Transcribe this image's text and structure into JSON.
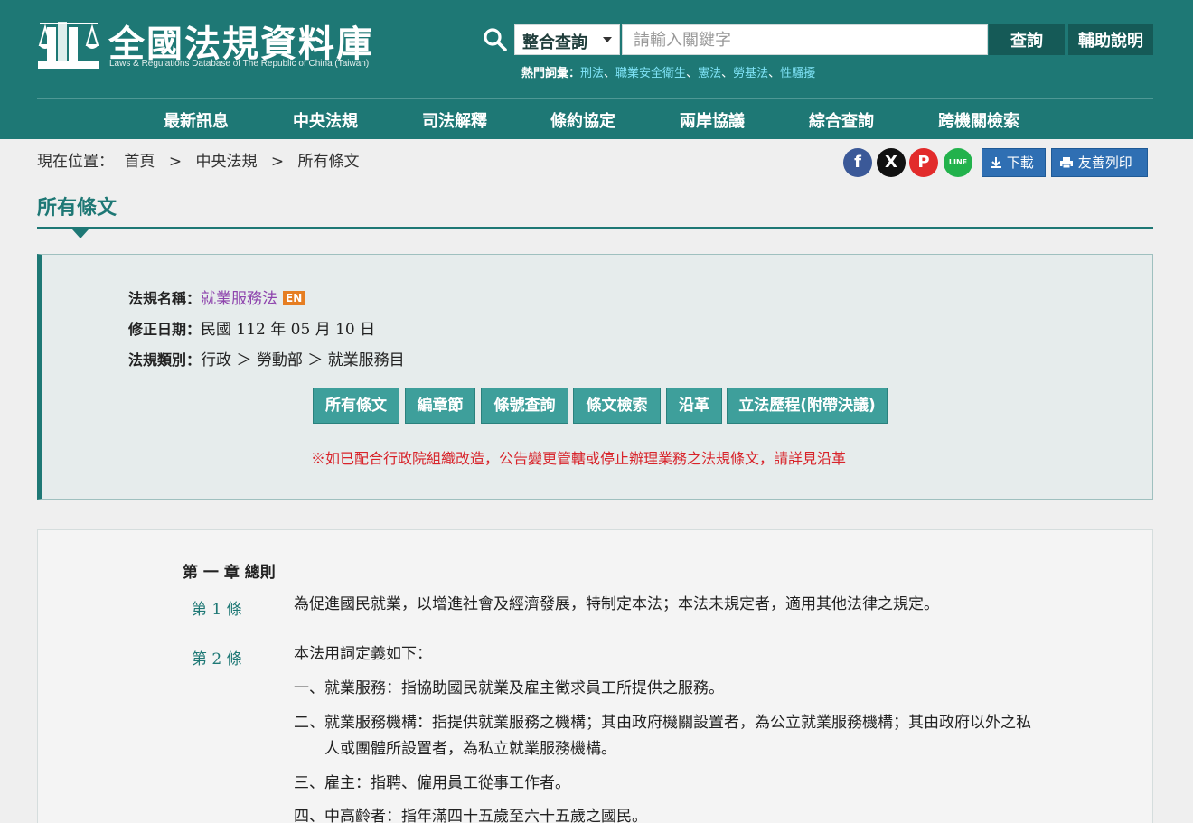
{
  "header": {
    "logo_title": "全國法規資料庫",
    "logo_subtitle": "Laws & Regulations Database of The Republic of China (Taiwan)",
    "search_type": "整合查詢",
    "search_placeholder": "請輸入關鍵字",
    "search_button": "查詢",
    "help_button": "輔助說明",
    "hot_label": "熱門詞彙：",
    "hot_keywords": [
      "刑法",
      "職業安全衛生",
      "憲法",
      "勞基法",
      "性騷擾"
    ],
    "hot_separator": "、"
  },
  "nav": {
    "items": [
      "最新訊息",
      "中央法規",
      "司法解釋",
      "條約協定",
      "兩岸協議",
      "綜合查詢",
      "跨機關檢索"
    ]
  },
  "breadcrumb": {
    "label": "現在位置：",
    "items": [
      "首頁",
      "中央法規",
      "所有條文"
    ],
    "separator": ">"
  },
  "toolbar": {
    "download": "下載",
    "print": "友善列印",
    "social": {
      "facebook": "f",
      "x": "X",
      "pinterest": "P",
      "line": "LINE"
    }
  },
  "page_title": "所有條文",
  "info": {
    "name_label": "法規名稱：",
    "name_value": "就業服務法",
    "en_badge": "EN",
    "date_label": "修正日期：",
    "date_value": "民國 112 年 05 月 10 日",
    "category_label": "法規類別：",
    "category_value": "行政 ＞ 勞動部 ＞ 就業服務目",
    "tabs": [
      "所有條文",
      "編章節",
      "條號查詢",
      "條文檢索",
      "沿革",
      "立法歷程(附帶決議)"
    ],
    "note": "※如已配合行政院組織改造，公告變更管轄或停止辦理業務之法規條文，請詳見沿革"
  },
  "content": {
    "chapter": "第 一 章 總則",
    "articles": [
      {
        "no": "第 1 條",
        "lines": [
          "為促進國民就業，以增進社會及經濟發展，特制定本法；本法未規定者，適用其他法律之規定。"
        ]
      },
      {
        "no": "第 2 條",
        "lines": [
          "本法用詞定義如下：",
          "一、就業服務：指協助國民就業及雇主徵求員工所提供之服務。",
          "二、就業服務機構：指提供就業服務之機構；其由政府機關設置者，為公立就業服務機構；其由政府以外之私",
          "　　人或團體所設置者，為私立就業服務機構。",
          "三、雇主：指聘、僱用員工從事工作者。",
          "四、中高齡者：指年滿四十五歲至六十五歲之國民。"
        ]
      }
    ]
  },
  "colors": {
    "primary": "#1e7875",
    "accent_link": "#7fe3f7",
    "notice": "#d8232a",
    "tab": "#3e9f9b"
  }
}
